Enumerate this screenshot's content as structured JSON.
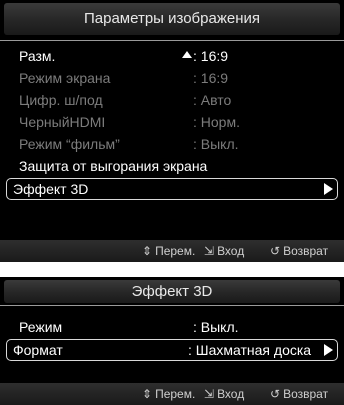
{
  "picture_menu": {
    "title": "Параметры изображения",
    "rows": [
      {
        "label": "Разм.",
        "value": ": 16:9",
        "state": "active"
      },
      {
        "label": "Режим экрана",
        "value": ": 16:9",
        "state": "dim"
      },
      {
        "label": "Цифр. ш/под",
        "value": ": Авто",
        "state": "dim"
      },
      {
        "label": "ЧерныйHDMI",
        "value": ": Норм.",
        "state": "dim"
      },
      {
        "label": "Режим “фильм”",
        "value": ": Выкл.",
        "state": "dim"
      },
      {
        "label": "Защита от выгорания экрана",
        "value": "",
        "state": "active"
      },
      {
        "label": "Эффект 3D",
        "value": "",
        "state": "selected"
      }
    ],
    "footer": {
      "move_icon": "up-down-arrows-icon",
      "move": "Перем.",
      "enter_icon": "enter-icon",
      "enter": "Вход",
      "return_icon": "return-icon",
      "return": "Возврат"
    }
  },
  "effect_3d_menu": {
    "title": "Эффект 3D",
    "rows": [
      {
        "label": "Режим",
        "value": ": Выкл.",
        "state": "active"
      },
      {
        "label": "Формат",
        "value": ": Шахматная доска",
        "state": "selected"
      }
    ],
    "footer": {
      "move_icon": "up-down-arrows-icon",
      "move": "Перем.",
      "enter_icon": "enter-icon",
      "enter": "Вход",
      "return_icon": "return-icon",
      "return": "Возврат"
    }
  },
  "colors": {
    "background": "#000000",
    "text_active": "#ffffff",
    "text_dim": "#7c7c7c",
    "selection_border": "#d9d9d9"
  }
}
